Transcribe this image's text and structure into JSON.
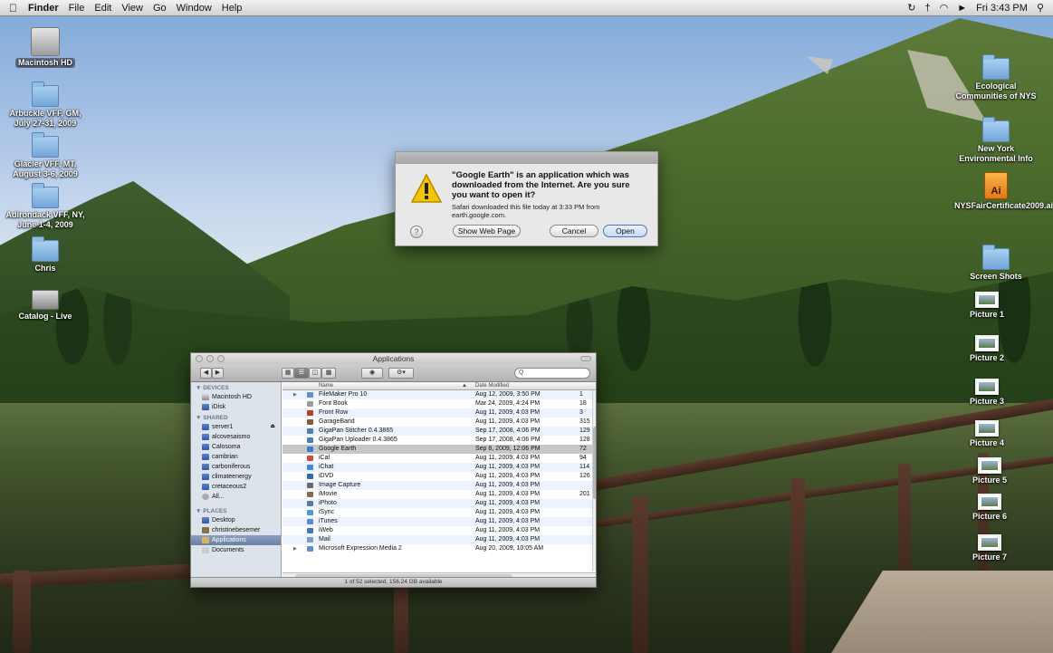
{
  "menubar": {
    "apple": "",
    "items": [
      "Finder",
      "File",
      "Edit",
      "View",
      "Go",
      "Window",
      "Help"
    ],
    "clock": "Fri 3:43 PM"
  },
  "desktop_icons_left": [
    {
      "name": "Macintosh HD",
      "icon": "hard-drive-icon"
    },
    {
      "name": "Arbuckle VFF, GM, July 27-31, 2009",
      "icon": "folder-icon"
    },
    {
      "name": "Glacier VFF, MT, August 3-6, 2009",
      "icon": "folder-icon"
    },
    {
      "name": "Adirondack VFF, NY, June 1-4, 2009",
      "icon": "folder-icon"
    },
    {
      "name": "Chris",
      "icon": "folder-icon"
    },
    {
      "name": "Catalog - Live",
      "icon": "server-icon"
    }
  ],
  "desktop_icons_right": [
    {
      "name": "Ecological Communities of NYS",
      "icon": "folder-icon"
    },
    {
      "name": "New York Environmental Info",
      "icon": "folder-icon"
    },
    {
      "name": "NYSFairCertificate2009.ai",
      "icon": "illustrator-icon"
    },
    {
      "name": "Screen Shots",
      "icon": "folder-icon"
    },
    {
      "name": "Picture 1",
      "icon": "picture-icon"
    },
    {
      "name": "Picture 2",
      "icon": "picture-icon"
    },
    {
      "name": "Picture 3",
      "icon": "picture-icon"
    },
    {
      "name": "Picture 4",
      "icon": "picture-icon"
    },
    {
      "name": "Picture 5",
      "icon": "picture-icon"
    },
    {
      "name": "Picture 6",
      "icon": "picture-icon"
    },
    {
      "name": "Picture 7",
      "icon": "picture-icon"
    }
  ],
  "dialog": {
    "message": "\"Google Earth\" is an application which was downloaded from the Internet. Are you sure you want to open it?",
    "info": "Safari downloaded this file today at 3:33 PM from earth.google.com.",
    "help_label": "?",
    "show_web_page": "Show Web Page",
    "cancel": "Cancel",
    "open": "Open"
  },
  "finder": {
    "title": "Applications",
    "search_placeholder": "Q",
    "columns": {
      "name": "Name",
      "date": "Date Modified"
    },
    "sidebar": {
      "devices_header": "▼ DEVICES",
      "devices": [
        "Macintosh HD",
        "iDisk"
      ],
      "shared_header": "▼ SHARED",
      "shared": [
        "server1",
        "alcovesaismo",
        "Calosoma",
        "cambrian",
        "carboniferous",
        "climateenergy",
        "cretaceous2",
        "All..."
      ],
      "places_header": "▼ PLACES",
      "places": [
        "Desktop",
        "christinebesemer",
        "Applications",
        "Documents"
      ]
    },
    "rows": [
      {
        "name": "FileMaker Pro 10",
        "date": "Aug 12, 2009, 3:50 PM",
        "size": "1",
        "folder": true
      },
      {
        "name": "Font Book",
        "date": "Mar 24, 2009, 4:24 PM",
        "size": "18"
      },
      {
        "name": "Front Row",
        "date": "Aug 11, 2009, 4:03 PM",
        "size": "3"
      },
      {
        "name": "GarageBand",
        "date": "Aug 11, 2009, 4:03 PM",
        "size": "315"
      },
      {
        "name": "GigaPan Stitcher 0.4.3865",
        "date": "Sep 17, 2008, 4:06 PM",
        "size": "129"
      },
      {
        "name": "GigaPan Uploader 0.4.3865",
        "date": "Sep 17, 2008, 4:06 PM",
        "size": "128"
      },
      {
        "name": "Google Earth",
        "date": "Sep 8, 2009, 12:06 PM",
        "size": "72"
      },
      {
        "name": "iCal",
        "date": "Aug 11, 2009, 4:03 PM",
        "size": "94"
      },
      {
        "name": "iChat",
        "date": "Aug 11, 2009, 4:03 PM",
        "size": "114"
      },
      {
        "name": "iDVD",
        "date": "Aug 11, 2009, 4:03 PM",
        "size": "126"
      },
      {
        "name": "Image Capture",
        "date": "Aug 11, 2009, 4:03 PM",
        "size": ""
      },
      {
        "name": "iMovie",
        "date": "Aug 11, 2009, 4:03 PM",
        "size": "201"
      },
      {
        "name": "iPhoto",
        "date": "Aug 11, 2009, 4:03 PM",
        "size": ""
      },
      {
        "name": "iSync",
        "date": "Aug 11, 2009, 4:03 PM",
        "size": ""
      },
      {
        "name": "iTunes",
        "date": "Aug 11, 2009, 4:03 PM",
        "size": ""
      },
      {
        "name": "iWeb",
        "date": "Aug 11, 2009, 4:03 PM",
        "size": ""
      },
      {
        "name": "Mail",
        "date": "Aug 11, 2009, 4:03 PM",
        "size": ""
      },
      {
        "name": "Microsoft Expression Media 2",
        "date": "Aug 20, 2009, 10:05 AM",
        "size": "",
        "folder": true
      }
    ],
    "status": "1 of 52 selected, 156.24 GB available"
  }
}
